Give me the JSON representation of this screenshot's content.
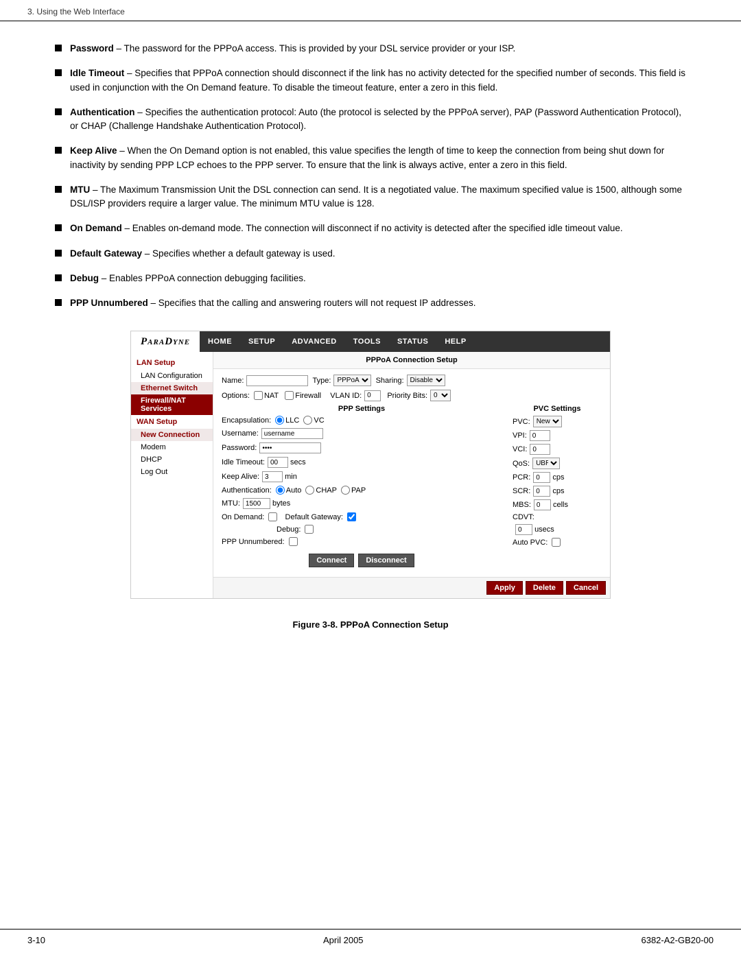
{
  "header": {
    "text": "3. Using the Web Interface"
  },
  "bullets": [
    {
      "term": "Password",
      "desc": "– The password for the PPPoA access. This is provided by your DSL service provider or your ISP."
    },
    {
      "term": "Idle Timeout",
      "desc": "– Specifies that PPPoA connection should disconnect if the link has no activity detected for the specified number of seconds. This field is used in conjunction with the On Demand feature. To disable the timeout feature, enter a zero in this field."
    },
    {
      "term": "Authentication",
      "desc": "– Specifies the authentication protocol: Auto (the protocol is selected by the PPPoA server), PAP (Password Authentication Protocol), or CHAP (Challenge Handshake Authentication Protocol)."
    },
    {
      "term": "Keep Alive",
      "desc": "– When the On Demand option is not enabled, this value specifies the length of time to keep the connection from being shut down for inactivity by sending PPP LCP echoes to the PPP server. To ensure that the link is always active, enter a zero in this field."
    },
    {
      "term": "MTU",
      "desc": "– The Maximum Transmission Unit the DSL connection can send. It is a negotiated value. The maximum specified value is 1500, although some DSL/ISP providers require a larger value. The minimum MTU value is 128."
    },
    {
      "term": "On Demand",
      "desc": "– Enables on-demand mode. The connection will disconnect if no activity is detected after the specified idle timeout value."
    },
    {
      "term": "Default Gateway",
      "desc": "– Specifies whether a default gateway is used."
    },
    {
      "term": "Debug",
      "desc": "– Enables PPPoA connection debugging facilities."
    },
    {
      "term": "PPP Unnumbered",
      "desc": "– Specifies that the calling and answering routers will not request IP addresses."
    }
  ],
  "ui": {
    "logo": "PARADYNE",
    "nav": [
      "HOME",
      "SETUP",
      "ADVANCED",
      "TOOLS",
      "STATUS",
      "HELP"
    ],
    "sidebar": {
      "sections": [
        {
          "label": "LAN Setup",
          "items": [
            "LAN Configuration",
            "Ethernet Switch",
            "Firewall/NAT Services"
          ]
        },
        {
          "label": "WAN Setup",
          "items": [
            "New Connection",
            "Modem",
            "DHCP",
            "Log Out"
          ]
        }
      ]
    },
    "section_title": "PPPoA Connection Setup",
    "form": {
      "name_label": "Name:",
      "name_value": "",
      "type_label": "Type:",
      "type_value": "PPPoA",
      "sharing_label": "Sharing:",
      "sharing_value": "Disable",
      "options_label": "Options:",
      "nat_label": "NAT",
      "firewall_label": "Firewall",
      "vlan_label": "VLAN ID:",
      "vlan_value": "0",
      "priority_label": "Priority Bits:",
      "priority_value": "0",
      "ppp_settings_title": "PPP Settings",
      "encapsulation_label": "Encapsulation:",
      "enc_llc": "LLC",
      "enc_vc": "VC",
      "username_label": "Username:",
      "username_value": "username",
      "password_label": "Password:",
      "password_value": "****",
      "idle_timeout_label": "Idle Timeout:",
      "idle_timeout_value": "00",
      "idle_timeout_unit": "secs",
      "keep_alive_label": "Keep Alive:",
      "keep_alive_value": "3",
      "keep_alive_unit": "min",
      "auth_label": "Authentication:",
      "auth_auto": "Auto",
      "auth_chap": "CHAP",
      "auth_pap": "PAP",
      "mtu_label": "MTU:",
      "mtu_value": "1500",
      "mtu_unit": "bytes",
      "on_demand_label": "On Demand:",
      "default_gw_label": "Default Gateway:",
      "debug_label": "Debug:",
      "ppp_unnumbered_label": "PPP Unnumbered:",
      "connect_btn": "Connect",
      "disconnect_btn": "Disconnect",
      "pvc_settings_title": "PVC Settings",
      "pvc_label": "PVC:",
      "pvc_value": "New",
      "vpi_label": "VPI:",
      "vpi_value": "0",
      "vci_label": "VCI:",
      "vci_value": "0",
      "qos_label": "QoS:",
      "qos_value": "UBR",
      "pcr_label": "PCR:",
      "pcr_value": "0",
      "pcr_unit": "cps",
      "scr_label": "SCR:",
      "scr_value": "0",
      "scr_unit": "cps",
      "mbs_label": "MBS:",
      "mbs_value": "0",
      "mbs_unit": "cells",
      "cdvt_label": "CDVT:",
      "cdvt_value": "0",
      "cdvt_unit": "usecs",
      "auto_pvc_label": "Auto PVC:",
      "apply_btn": "Apply",
      "delete_btn": "Delete",
      "cancel_btn": "Cancel"
    }
  },
  "figure_caption": "Figure 3-8.    PPPoA Connection Setup",
  "footer": {
    "page_number": "3-10",
    "date": "April 2005",
    "doc_number": "6382-A2-GB20-00"
  }
}
